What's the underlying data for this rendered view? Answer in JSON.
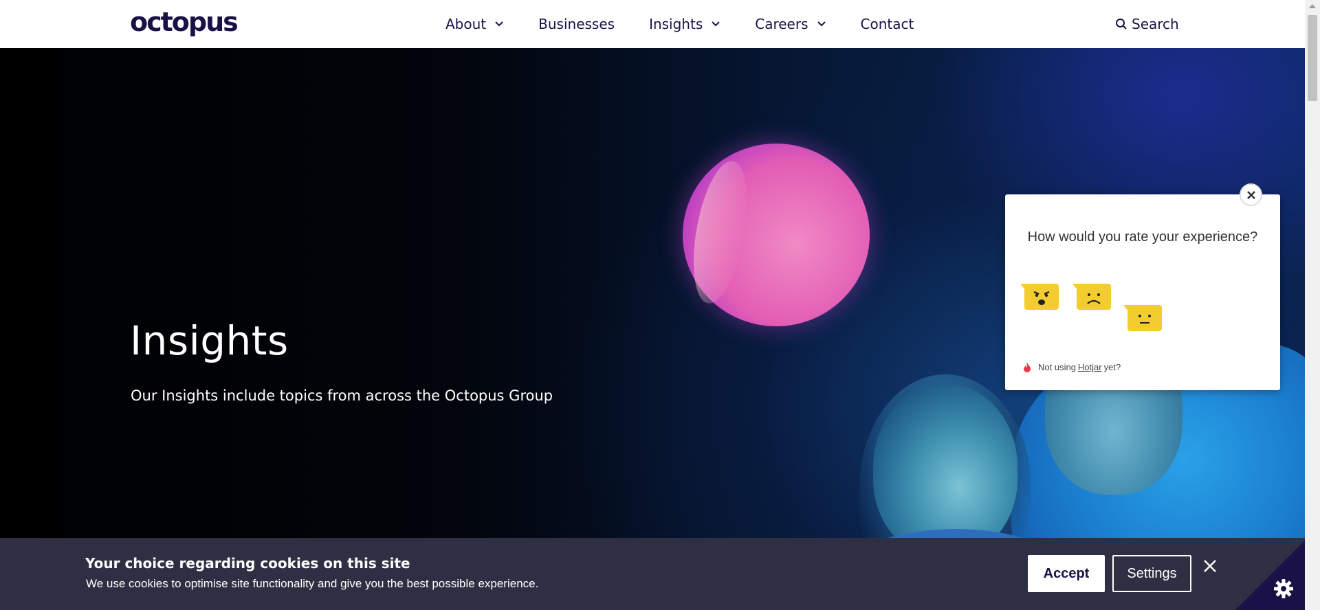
{
  "header": {
    "logo": "octopus",
    "nav": [
      {
        "label": "About",
        "dropdown": true
      },
      {
        "label": "Businesses",
        "dropdown": false
      },
      {
        "label": "Insights",
        "dropdown": true
      },
      {
        "label": "Careers",
        "dropdown": true
      },
      {
        "label": "Contact",
        "dropdown": false
      }
    ],
    "search_label": "Search",
    "search_icon": "search-icon",
    "text_color": "#1a1147"
  },
  "hero": {
    "title": "Insights",
    "subtitle": "Our Insights include topics from across the Octopus Group"
  },
  "survey": {
    "question": "How would you rate your experience?",
    "ratings": [
      "angry",
      "sad",
      "neutral"
    ],
    "footer_prefix": "Not using",
    "footer_link": "Hotjar",
    "footer_suffix": "yet?",
    "emoji_color": "#f3cc2f"
  },
  "cookie_banner": {
    "title": "Your choice regarding cookies on this site",
    "text": "We use cookies to optimise site functionality and give you the best possible experience.",
    "accept_label": "Accept",
    "settings_label": "Settings",
    "background": "#2f2f44"
  }
}
